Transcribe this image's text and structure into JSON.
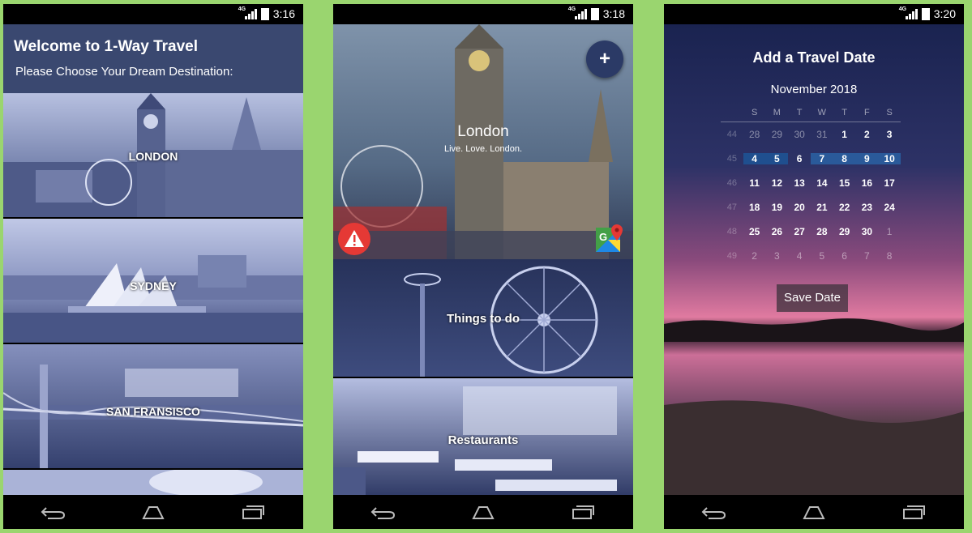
{
  "screens": [
    {
      "time": "3:16",
      "network": "4G",
      "header": {
        "title": "Welcome to 1-Way Travel",
        "subtitle": "Please Choose Your Dream Destination:"
      },
      "destinations": [
        "LONDON",
        "SYDNEY",
        "SAN FRANSISCO"
      ]
    },
    {
      "time": "3:18",
      "network": "4G",
      "fab_label": "+",
      "city": {
        "name": "London",
        "tagline": "Live. Love. London."
      },
      "cards": [
        "Things to do",
        "Restaurants"
      ],
      "icons": {
        "warning": "warning-icon",
        "maps": "google-maps-icon"
      }
    },
    {
      "time": "3:20",
      "network": "4G",
      "title": "Add a Travel Date",
      "month": "November 2018",
      "weekdays": [
        "S",
        "M",
        "T",
        "W",
        "T",
        "F",
        "S"
      ],
      "weeks": [
        {
          "wk": "44",
          "days": [
            "28",
            "29",
            "30",
            "31",
            "1",
            "2",
            "3"
          ]
        },
        {
          "wk": "45",
          "days": [
            "4",
            "5",
            "6",
            "7",
            "8",
            "9",
            "10"
          ]
        },
        {
          "wk": "46",
          "days": [
            "11",
            "12",
            "13",
            "14",
            "15",
            "16",
            "17"
          ]
        },
        {
          "wk": "47",
          "days": [
            "18",
            "19",
            "20",
            "21",
            "22",
            "23",
            "24"
          ]
        },
        {
          "wk": "48",
          "days": [
            "25",
            "26",
            "27",
            "28",
            "29",
            "30",
            "1"
          ]
        },
        {
          "wk": "49",
          "days": [
            "2",
            "3",
            "4",
            "5",
            "6",
            "7",
            "8"
          ]
        }
      ],
      "save_label": "Save Date"
    }
  ],
  "colors": {
    "background": "#9ad56f",
    "header": "#3a4870",
    "fab": "#2b3a66",
    "warning": "#e53935",
    "selected_week": "#1f4f8f"
  }
}
